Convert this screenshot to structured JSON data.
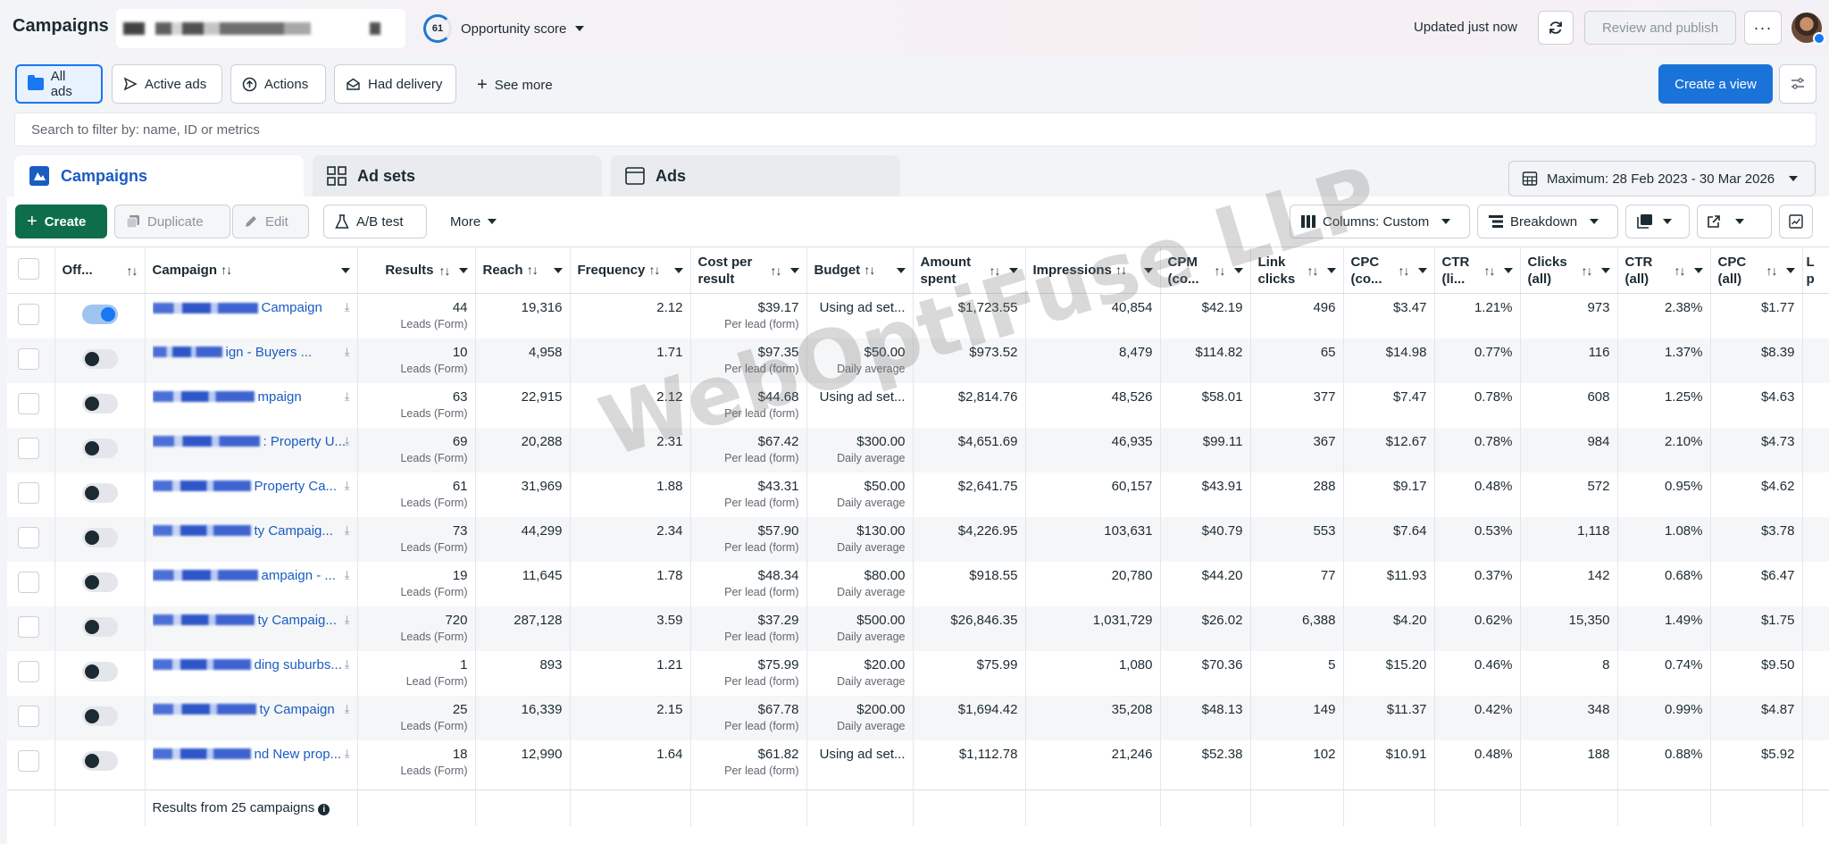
{
  "header": {
    "title": "Campaigns",
    "opportunity_score": "61",
    "opportunity_label": "Opportunity score",
    "updated": "Updated just now",
    "review_label": "Review and publish"
  },
  "views": {
    "tabs": [
      "All ads",
      "Active ads",
      "Actions",
      "Had delivery"
    ],
    "see_more": "See more",
    "create_view": "Create a view"
  },
  "search": {
    "placeholder": "Search to filter by: name, ID or metrics"
  },
  "levels": {
    "campaigns": "Campaigns",
    "adsets": "Ad sets",
    "ads": "Ads"
  },
  "date_range": "Maximum: 28 Feb 2023 - 30 Mar 2026",
  "toolbar": {
    "create": "Create",
    "duplicate": "Duplicate",
    "edit": "Edit",
    "ab_test": "A/B test",
    "more": "More",
    "columns": "Columns: Custom",
    "breakdown": "Breakdown"
  },
  "columns": [
    "Off...",
    "Campaign",
    "Results",
    "Reach",
    "Frequency",
    "Cost per result",
    "Budget",
    "Amount spent",
    "Impressions",
    "CPM (co...",
    "Link clicks",
    "CPC (co...",
    "CTR (li...",
    "Clicks (all)",
    "CTR (all)",
    "CPC (all)",
    "L p"
  ],
  "rows": [
    {
      "on": true,
      "name": "Campaign",
      "results": "44",
      "results_sub": "Leads (Form)",
      "reach": "19,316",
      "freq": "2.12",
      "cpr": "$39.17",
      "cpr_sub": "Per lead (form)",
      "budget": "Using ad set...",
      "budget_sub": "",
      "spent": "$1,723.55",
      "impr": "40,854",
      "cpm": "$42.19",
      "link": "496",
      "cpc": "$3.47",
      "ctrl": "1.21%",
      "clicks": "973",
      "ctra": "2.38%",
      "cpca": "$1.77"
    },
    {
      "on": false,
      "name": "ign - Buyers ...",
      "results": "10",
      "results_sub": "Leads (Form)",
      "reach": "4,958",
      "freq": "1.71",
      "cpr": "$97.35",
      "cpr_sub": "Per lead (form)",
      "budget": "$50.00",
      "budget_sub": "Daily average",
      "spent": "$973.52",
      "impr": "8,479",
      "cpm": "$114.82",
      "link": "65",
      "cpc": "$14.98",
      "ctrl": "0.77%",
      "clicks": "116",
      "ctra": "1.37%",
      "cpca": "$8.39"
    },
    {
      "on": false,
      "name": "mpaign",
      "results": "63",
      "results_sub": "Leads (Form)",
      "reach": "22,915",
      "freq": "2.12",
      "cpr": "$44.68",
      "cpr_sub": "Per lead (form)",
      "budget": "Using ad set...",
      "budget_sub": "",
      "spent": "$2,814.76",
      "impr": "48,526",
      "cpm": "$58.01",
      "link": "377",
      "cpc": "$7.47",
      "ctrl": "0.78%",
      "clicks": "608",
      "ctra": "1.25%",
      "cpca": "$4.63"
    },
    {
      "on": false,
      "name": ": Property U...",
      "results": "69",
      "results_sub": "Leads (Form)",
      "reach": "20,288",
      "freq": "2.31",
      "cpr": "$67.42",
      "cpr_sub": "Per lead (form)",
      "budget": "$300.00",
      "budget_sub": "Daily average",
      "spent": "$4,651.69",
      "impr": "46,935",
      "cpm": "$99.11",
      "link": "367",
      "cpc": "$12.67",
      "ctrl": "0.78%",
      "clicks": "984",
      "ctra": "2.10%",
      "cpca": "$4.73"
    },
    {
      "on": false,
      "name": "Property Ca...",
      "results": "61",
      "results_sub": "Leads (Form)",
      "reach": "31,969",
      "freq": "1.88",
      "cpr": "$43.31",
      "cpr_sub": "Per lead (form)",
      "budget": "$50.00",
      "budget_sub": "Daily average",
      "spent": "$2,641.75",
      "impr": "60,157",
      "cpm": "$43.91",
      "link": "288",
      "cpc": "$9.17",
      "ctrl": "0.48%",
      "clicks": "572",
      "ctra": "0.95%",
      "cpca": "$4.62"
    },
    {
      "on": false,
      "name": "ty Campaig...",
      "results": "73",
      "results_sub": "Leads (Form)",
      "reach": "44,299",
      "freq": "2.34",
      "cpr": "$57.90",
      "cpr_sub": "Per lead (form)",
      "budget": "$130.00",
      "budget_sub": "Daily average",
      "spent": "$4,226.95",
      "impr": "103,631",
      "cpm": "$40.79",
      "link": "553",
      "cpc": "$7.64",
      "ctrl": "0.53%",
      "clicks": "1,118",
      "ctra": "1.08%",
      "cpca": "$3.78"
    },
    {
      "on": false,
      "name": "ampaign - ...",
      "results": "19",
      "results_sub": "Leads (Form)",
      "reach": "11,645",
      "freq": "1.78",
      "cpr": "$48.34",
      "cpr_sub": "Per lead (form)",
      "budget": "$80.00",
      "budget_sub": "Daily average",
      "spent": "$918.55",
      "impr": "20,780",
      "cpm": "$44.20",
      "link": "77",
      "cpc": "$11.93",
      "ctrl": "0.37%",
      "clicks": "142",
      "ctra": "0.68%",
      "cpca": "$6.47"
    },
    {
      "on": false,
      "name": "ty Campaig...",
      "results": "720",
      "results_sub": "Leads (Form)",
      "reach": "287,128",
      "freq": "3.59",
      "cpr": "$37.29",
      "cpr_sub": "Per lead (form)",
      "budget": "$500.00",
      "budget_sub": "Daily average",
      "spent": "$26,846.35",
      "impr": "1,031,729",
      "cpm": "$26.02",
      "link": "6,388",
      "cpc": "$4.20",
      "ctrl": "0.62%",
      "clicks": "15,350",
      "ctra": "1.49%",
      "cpca": "$1.75"
    },
    {
      "on": false,
      "name": "ding suburbs...",
      "results": "1",
      "results_sub": "Lead (Form)",
      "reach": "893",
      "freq": "1.21",
      "cpr": "$75.99",
      "cpr_sub": "Per lead (form)",
      "budget": "$20.00",
      "budget_sub": "Daily average",
      "spent": "$75.99",
      "impr": "1,080",
      "cpm": "$70.36",
      "link": "5",
      "cpc": "$15.20",
      "ctrl": "0.46%",
      "clicks": "8",
      "ctra": "0.74%",
      "cpca": "$9.50"
    },
    {
      "on": false,
      "name": "ty Campaign",
      "results": "25",
      "results_sub": "Leads (Form)",
      "reach": "16,339",
      "freq": "2.15",
      "cpr": "$67.78",
      "cpr_sub": "Per lead (form)",
      "budget": "$200.00",
      "budget_sub": "Daily average",
      "spent": "$1,694.42",
      "impr": "35,208",
      "cpm": "$48.13",
      "link": "149",
      "cpc": "$11.37",
      "ctrl": "0.42%",
      "clicks": "348",
      "ctra": "0.99%",
      "cpca": "$4.87"
    },
    {
      "on": false,
      "name": "nd New prop...",
      "results": "18",
      "results_sub": "Leads (Form)",
      "reach": "12,990",
      "freq": "1.64",
      "cpr": "$61.82",
      "cpr_sub": "Per lead (form)",
      "budget": "Using ad set...",
      "budget_sub": "",
      "spent": "$1,112.78",
      "impr": "21,246",
      "cpm": "$52.38",
      "link": "102",
      "cpc": "$10.91",
      "ctrl": "0.48%",
      "clicks": "188",
      "ctra": "0.88%",
      "cpca": "$5.92"
    }
  ],
  "footer": {
    "results_text": "Results from 25 campaigns"
  },
  "watermark": "WebOptiFuse LLP"
}
